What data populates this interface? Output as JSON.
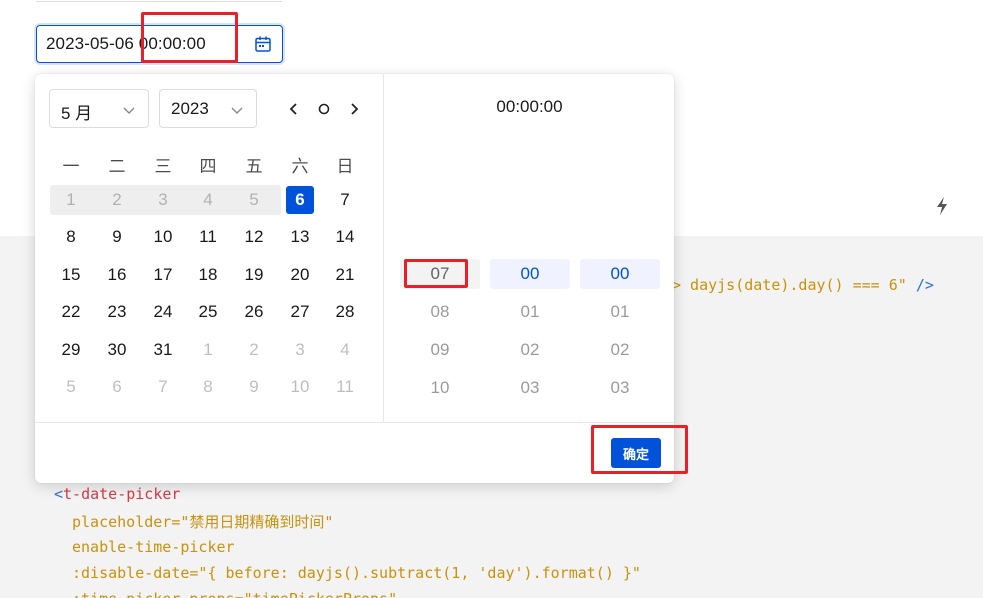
{
  "input": {
    "value": "2023-05-06 00:00:00"
  },
  "icons": {
    "calendar": "calendar-icon",
    "bolt": "lightning-icon",
    "chevron": "chevron-down-icon"
  },
  "panel": {
    "month_select": "5 月",
    "year_select": "2023",
    "nav": {
      "prev": "‹",
      "today": "○",
      "next": "›"
    },
    "weekdays": [
      "一",
      "二",
      "三",
      "四",
      "五",
      "六",
      "日"
    ],
    "weeks": [
      [
        "1",
        "2",
        "3",
        "4",
        "5",
        "6",
        "7"
      ],
      [
        "8",
        "9",
        "10",
        "11",
        "12",
        "13",
        "14"
      ],
      [
        "15",
        "16",
        "17",
        "18",
        "19",
        "20",
        "21"
      ],
      [
        "22",
        "23",
        "24",
        "25",
        "26",
        "27",
        "28"
      ],
      [
        "29",
        "30",
        "31",
        "1",
        "2",
        "3",
        "4"
      ],
      [
        "5",
        "6",
        "7",
        "8",
        "9",
        "10",
        "11"
      ]
    ],
    "time_header": "00:00:00",
    "hours": [
      "07",
      "08",
      "09",
      "10"
    ],
    "minutes": [
      "00",
      "01",
      "02",
      "03"
    ],
    "seconds": [
      "00",
      "01",
      "02",
      "03"
    ],
    "confirm_label": "确定"
  },
  "code": {
    "line_fragment_attr": "> dayjs(date).day() === 6\"",
    "line_fragment_close": "/>",
    "tag_bracket": "<",
    "tag_name": "t-date-picker",
    "attr_placeholder": "placeholder=\"禁用日期精确到时间\"",
    "attr_enable": "enable-time-picker",
    "attr_disable": ":disable-date=\"{ before: dayjs().subtract(1, 'day').format() }\"",
    "attr_time_props": ":time-picker-props=\"timePickerProps\""
  },
  "colors": {
    "primary": "#0052d9",
    "annotation": "#e8202a"
  }
}
